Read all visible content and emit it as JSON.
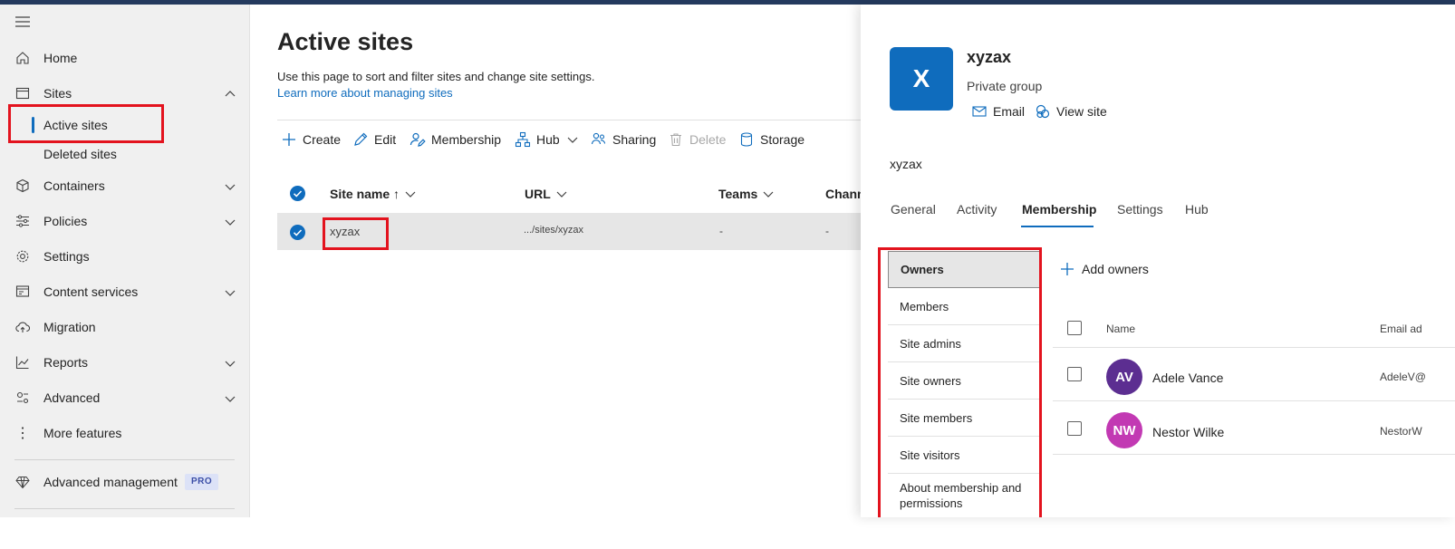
{
  "colors": {
    "accent": "#0f6cbd",
    "highlight": "#e3131e",
    "avatar_av": "#5c2e91",
    "avatar_nw": "#c239b3"
  },
  "sidebar": {
    "menu_icon": "hamburger-icon",
    "items": [
      {
        "label": "Home",
        "icon": "home-icon"
      },
      {
        "label": "Sites",
        "icon": "sites-icon",
        "expanded": true
      },
      {
        "label": "Containers",
        "icon": "container-icon"
      },
      {
        "label": "Policies",
        "icon": "policies-icon"
      },
      {
        "label": "Settings",
        "icon": "gear-icon"
      },
      {
        "label": "Content services",
        "icon": "content-services-icon"
      },
      {
        "label": "Migration",
        "icon": "cloud-upload-icon"
      },
      {
        "label": "Reports",
        "icon": "chart-icon"
      },
      {
        "label": "Advanced",
        "icon": "advanced-icon"
      },
      {
        "label": "More features",
        "icon": "more-icon"
      }
    ],
    "sites_sub": [
      "Active sites",
      "Deleted sites"
    ],
    "advanced_management": {
      "label": "Advanced management",
      "badge": "PRO",
      "icon": "diamond-icon"
    }
  },
  "main": {
    "title": "Active sites",
    "description": "Use this page to sort and filter sites and change site settings.",
    "learn_link": "Learn more about managing sites",
    "commands": [
      {
        "label": "Create",
        "icon": "plus-icon"
      },
      {
        "label": "Edit",
        "icon": "pencil-icon"
      },
      {
        "label": "Membership",
        "icon": "people-edit-icon"
      },
      {
        "label": "Hub",
        "icon": "hub-icon"
      },
      {
        "label": "Sharing",
        "icon": "sharing-icon"
      },
      {
        "label": "Delete",
        "icon": "trash-icon",
        "disabled": true
      },
      {
        "label": "Storage",
        "icon": "storage-icon"
      }
    ],
    "columns": [
      "Site name ↑",
      "URL",
      "Teams",
      "Chann"
    ],
    "rows": [
      {
        "site_name": "xyzax",
        "url": ".../sites/xyzax",
        "teams": "-",
        "channels": "-",
        "selected": true
      }
    ]
  },
  "panel": {
    "tile_letter": "X",
    "site_name": "xyzax",
    "site_type": "Private group",
    "email_label": "Email",
    "view_site_label": "View site",
    "site_subtitle": "xyzax",
    "tabs": [
      "General",
      "Activity",
      "Membership",
      "Settings",
      "Hub"
    ],
    "active_tab": "Membership",
    "membership_nav": [
      "Owners",
      "Members",
      "Site admins",
      "Site owners",
      "Site members",
      "Site visitors",
      "About membership and permissions"
    ],
    "add_owners_label": "Add owners",
    "member_columns": [
      "Name",
      "Email ad"
    ],
    "members": [
      {
        "initials": "AV",
        "name": "Adele Vance",
        "email": "AdeleV@"
      },
      {
        "initials": "NW",
        "name": "Nestor Wilke",
        "email": "NestorW"
      }
    ]
  }
}
